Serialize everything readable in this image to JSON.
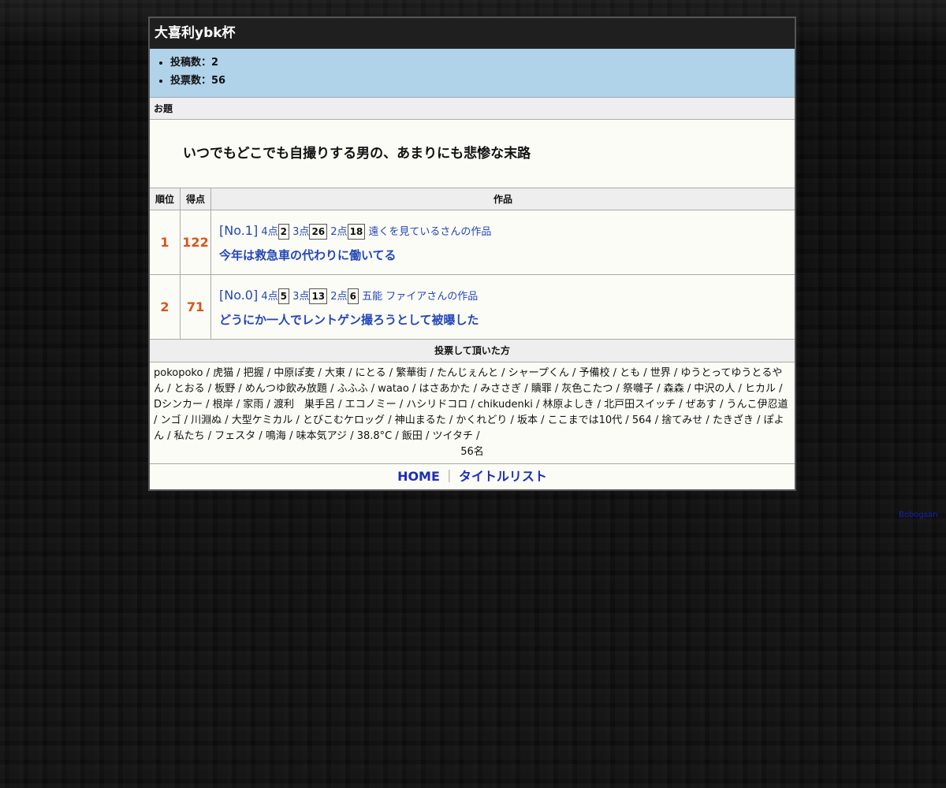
{
  "contest": {
    "title": "大喜利ybk杯"
  },
  "stats": [
    "投稿数：2",
    "投票数：56"
  ],
  "theme": {
    "header": "お題",
    "text": "いつでもどこでも自撮りする男の、あまりにも悲惨な末路"
  },
  "ranking": {
    "columns": [
      "順位",
      "得点",
      "作品"
    ],
    "rows": [
      {
        "rank": "1",
        "score": "122",
        "no": "[No.1]",
        "pt4_label": "4点",
        "pt4": "2",
        "pt3_label": "3点",
        "pt3": "26",
        "pt2_label": "2点",
        "pt2": "18",
        "author": "遠くを見ているさんの作品",
        "title": "今年は救急車の代わりに働いてる"
      },
      {
        "rank": "2",
        "score": "71",
        "no": "[No.0]",
        "pt4_label": "4点",
        "pt4": "5",
        "pt3_label": "3点",
        "pt3": "13",
        "pt2_label": "2点",
        "pt2": "6",
        "author": "五能 ファイアさんの作品",
        "title": "どうにか一人でレントゲン撮ろうとして被曝した"
      }
    ]
  },
  "voters": {
    "header": "投票して頂いた方",
    "list": "pokopoko / 虎猫 / 把握 / 中原ぽ麦 / 大東 / にとる / 繁華街 / たんじぇんと / シャープくん / 予備校 / とも / 世界 / ゆうとってゆうとるやん / とおる / 板野 / めんつゆ飲み放題 / ふふふ / watao / はさあかた / みささぎ / 贖罪 / 灰色こたつ / 祭囃子 / 森森 / 中沢の人 / ヒカル / Dシンカー / 根岸 / 家雨 / 渡利　巣手呂 / エコノミー / ハシリドコロ / chikudenki / 林原よしき / 北戸田スイッチ / ぜあす / うんこ伊忍道 / ンゴ / 川淵ぬ / 大型ケミカル / とびこむケロッグ / 神山まるた / かくれどり / 坂本 / ここまでは10代 / 564 / 捨てみせ / たきざき / ぽよん / 私たち / フェスタ / 鳴海 / 味本気アジ / 38.8°C / 飯田 / ツイタチ /",
    "total": "56名"
  },
  "footer": {
    "home": "HOME",
    "separator": "｜",
    "titles": "タイトルリスト"
  },
  "credit": "Bobogsan"
}
